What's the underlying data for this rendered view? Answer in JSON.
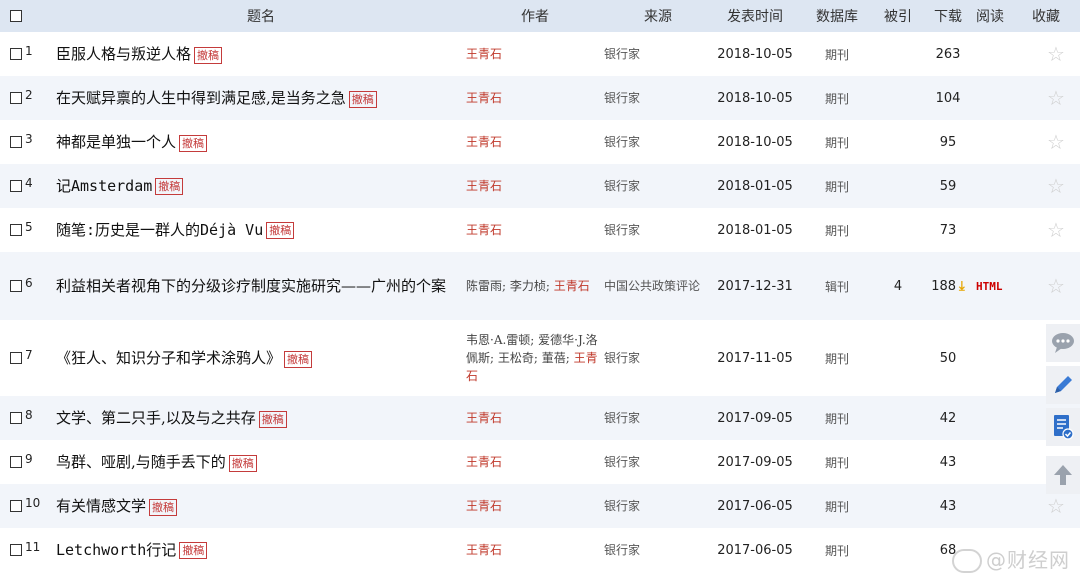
{
  "header": {
    "title": "题名",
    "author": "作者",
    "source": "来源",
    "date": "发表时间",
    "database": "数据库",
    "cited": "被引",
    "downloads": "下载",
    "read": "阅读",
    "favorite": "收藏"
  },
  "badge": "撤稿",
  "rows": [
    {
      "idx": "1",
      "title": "臣服人格与叛逆人格",
      "authors": "王青石",
      "source": "银行家",
      "date": "2018-10-05",
      "db": "期刊",
      "cited": "",
      "downloads": "263"
    },
    {
      "idx": "2",
      "title": "在天赋异禀的人生中得到满足感,是当务之急",
      "authors": "王青石",
      "source": "银行家",
      "date": "2018-10-05",
      "db": "期刊",
      "cited": "",
      "downloads": "104"
    },
    {
      "idx": "3",
      "title": "神都是单独一个人",
      "authors": "王青石",
      "source": "银行家",
      "date": "2018-10-05",
      "db": "期刊",
      "cited": "",
      "downloads": "95"
    },
    {
      "idx": "4",
      "title": "记Amsterdam",
      "authors": "王青石",
      "source": "银行家",
      "date": "2018-01-05",
      "db": "期刊",
      "cited": "",
      "downloads": "59"
    },
    {
      "idx": "5",
      "title": "随笔:历史是一群人的Déjà Vu",
      "authors": "王青石",
      "source": "银行家",
      "date": "2018-01-05",
      "db": "期刊",
      "cited": "",
      "downloads": "73"
    },
    {
      "idx": "6",
      "title": "利益相关者视角下的分级诊疗制度实施研究——广州的个案",
      "authors_plain": "陈雷雨; 李力桢; ",
      "authors": "王青石",
      "source": "中国公共政策评论",
      "date": "2017-12-31",
      "db": "辑刊",
      "cited": "4",
      "downloads": "188",
      "html": "HTML"
    },
    {
      "idx": "7",
      "title": "《狂人、知识分子和学术涂鸦人》",
      "authors_plain": "韦恩·A.雷顿; 爱德华·J.洛佩斯; 王松奇; 董蓓; ",
      "authors": "王青石",
      "source": "银行家",
      "date": "2017-11-05",
      "db": "期刊",
      "cited": "",
      "downloads": "50"
    },
    {
      "idx": "8",
      "title": "文学、第二只手,以及与之共存",
      "authors": "王青石",
      "source": "银行家",
      "date": "2017-09-05",
      "db": "期刊",
      "cited": "",
      "downloads": "42"
    },
    {
      "idx": "9",
      "title": "鸟群、哑剧,与随手丢下的",
      "authors": "王青石",
      "source": "银行家",
      "date": "2017-09-05",
      "db": "期刊",
      "cited": "",
      "downloads": "43"
    },
    {
      "idx": "10",
      "title": "有关情感文学",
      "authors": "王青石",
      "source": "银行家",
      "date": "2017-06-05",
      "db": "期刊",
      "cited": "",
      "downloads": "43"
    },
    {
      "idx": "11",
      "title": "Letchworth行记",
      "authors": "王青石",
      "source": "银行家",
      "date": "2017-06-05",
      "db": "期刊",
      "cited": "",
      "downloads": "68"
    }
  ],
  "watermark": "@财经网",
  "colors": {
    "header_bg": "#dde6f2",
    "row_alt": "#f2f5fa",
    "author": "#c0392b",
    "badge": "#c43b3b",
    "html": "#cc0000"
  }
}
